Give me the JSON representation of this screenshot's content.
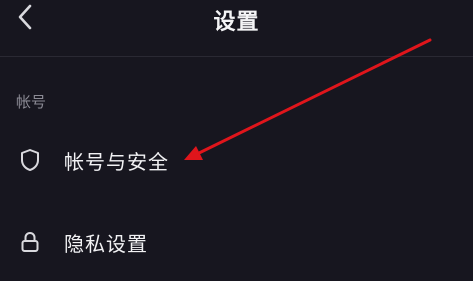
{
  "header": {
    "title": "设置",
    "back_icon": "chevron-left-icon"
  },
  "section": {
    "label": "帐号"
  },
  "items": [
    {
      "label": "帐号与安全",
      "icon": "shield-icon"
    },
    {
      "label": "隐私设置",
      "icon": "lock-icon"
    }
  ],
  "colors": {
    "background": "#17161f",
    "text_primary": "#f2f2f4",
    "text_secondary": "#8b8a94",
    "annotation_arrow": "#e0151b"
  }
}
